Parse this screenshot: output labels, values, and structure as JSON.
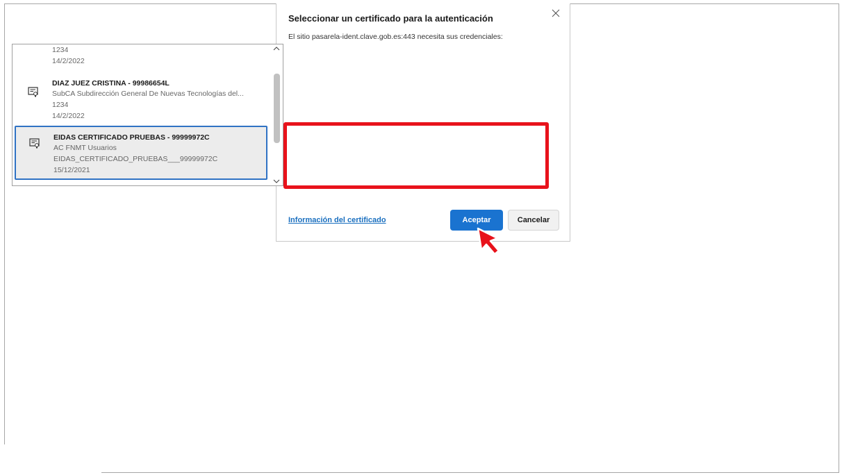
{
  "dialog": {
    "title": "Seleccionar un certificado para la autenticación",
    "subtitle": "El sitio pasarela-ident.clave.gob.es:443 necesita sus credenciales:",
    "close_icon": "close-icon"
  },
  "certificates": [
    {
      "lines": [
        "1234",
        "14/2/2022"
      ]
    },
    {
      "name": "DIAZ JUEZ CRISTINA - 99986654L",
      "lines": [
        "SubCA Subdirección General De Nuevas Tecnologías del...",
        "1234",
        "14/2/2022"
      ],
      "icon": "certificate-icon"
    },
    {
      "name": "EIDAS CERTIFICADO PRUEBAS - 99999972C",
      "lines": [
        "AC FNMT Usuarios",
        "EIDAS_CERTIFICADO_PRUEBAS___99999972C",
        "15/12/2021"
      ],
      "icon": "certificate-icon",
      "selected": true
    }
  ],
  "footer": {
    "info_link": "Información del certificado",
    "accept_label": "Aceptar",
    "cancel_label": "Cancelar"
  },
  "colors": {
    "accent": "#1a73d0",
    "highlight": "#e8121b",
    "selection_border": "#2f72c4"
  }
}
